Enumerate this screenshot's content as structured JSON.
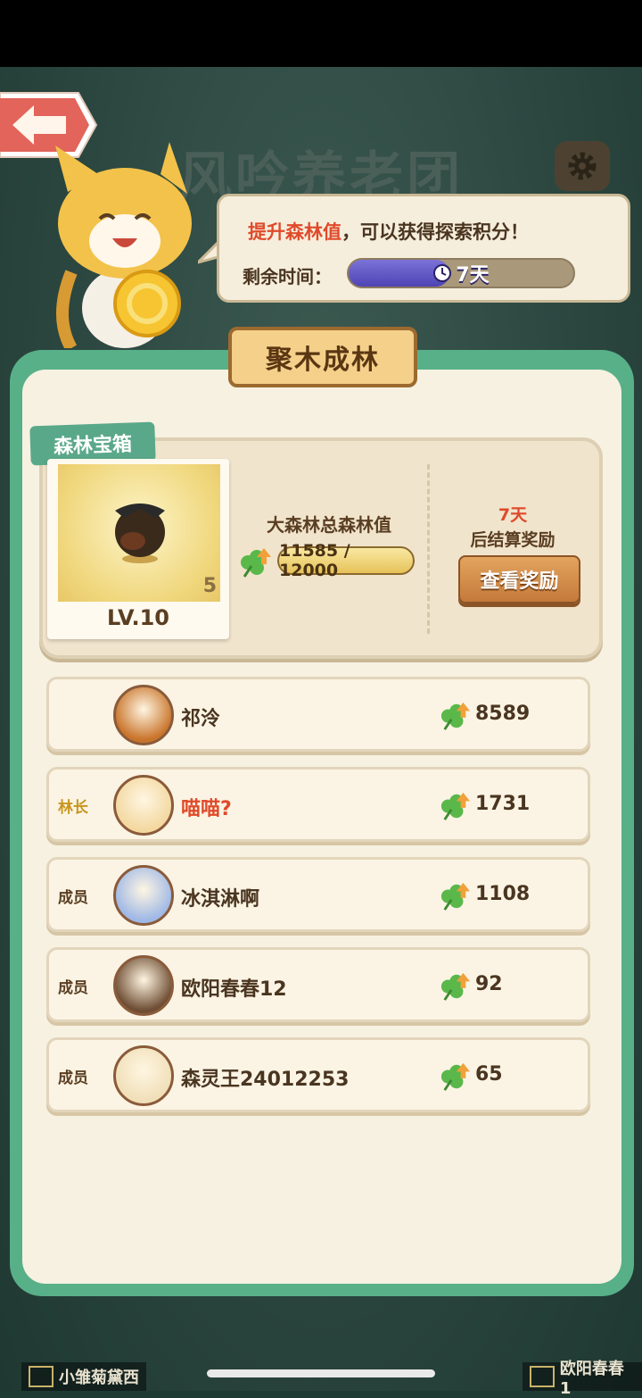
{
  "header": {
    "title": "风吟养老团"
  },
  "tip": {
    "prefix": "提升森林值",
    "suffix": "，可以获得探索积分！",
    "time_label": "剩余时间：",
    "time_value": "7天",
    "time_progress": 0.45
  },
  "panel": {
    "title": "聚木成林"
  },
  "chest": {
    "tag": "森林宝箱",
    "count": "5",
    "level": "LV.10",
    "forest_label": "大森林总森林值",
    "forest_value": "11585 / 12000",
    "settle_days": "7天",
    "settle_text": "后结算奖励",
    "reward_button": "查看奖励"
  },
  "members": [
    {
      "role": "",
      "name": "祁泠",
      "score": "8589",
      "self": false,
      "avatar_color": "#c9742b"
    },
    {
      "role": "林长",
      "name": "喵喵?",
      "score": "1731",
      "self": true,
      "leader": true,
      "avatar_color": "#f3d8a0"
    },
    {
      "role": "成员",
      "name": "冰淇淋啊",
      "score": "1108",
      "self": false,
      "avatar_color": "#9fb8e6"
    },
    {
      "role": "成员",
      "name": "欧阳春春12",
      "score": "92",
      "self": false,
      "avatar_color": "#6f4e34"
    },
    {
      "role": "成员",
      "name": "森灵王24012253",
      "score": "65",
      "self": false,
      "avatar_color": "#f0dfb8"
    }
  ],
  "bottom": {
    "left_label": "小雏菊黛西",
    "right_label": "欧阳春春1"
  },
  "colors": {
    "panel_green": "#58b088",
    "highlight_red": "#e04a2a",
    "leader_gold": "#c9951e"
  }
}
